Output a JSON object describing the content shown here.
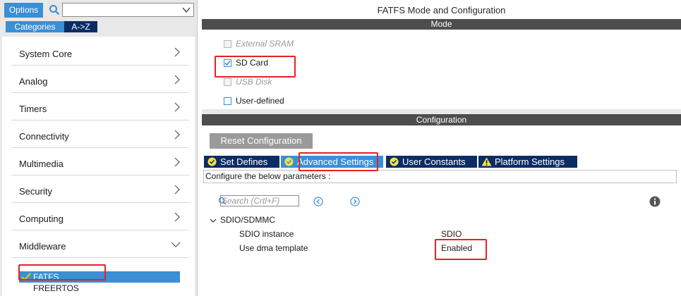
{
  "left_panel": {
    "options_button": "Options",
    "search_value": "",
    "tabs": {
      "categories": "Categories",
      "az": "A->Z"
    },
    "categories": [
      {
        "label": "System Core",
        "arrow": "chevron-right-icon"
      },
      {
        "label": "Analog",
        "arrow": "chevron-right-icon"
      },
      {
        "label": "Timers",
        "arrow": "chevron-right-icon"
      },
      {
        "label": "Connectivity",
        "arrow": "chevron-right-icon"
      },
      {
        "label": "Multimedia",
        "arrow": "chevron-right-icon"
      },
      {
        "label": "Security",
        "arrow": "chevron-right-icon"
      },
      {
        "label": "Computing",
        "arrow": "chevron-right-icon"
      },
      {
        "label": "Middleware",
        "arrow": "chevron-down-icon"
      }
    ],
    "middleware_items": [
      {
        "label": "FATFS",
        "selected": true
      },
      {
        "label": "FREERTOS",
        "selected": false
      }
    ]
  },
  "right_panel": {
    "title": "FATFS Mode and Configuration",
    "mode_header": "Mode",
    "mode_options": [
      {
        "label": "External SRAM",
        "checked": false,
        "enabled": false
      },
      {
        "label": "SD Card",
        "checked": true,
        "enabled": true
      },
      {
        "label": "USB Disk",
        "checked": false,
        "enabled": false
      },
      {
        "label": "User-defined",
        "checked": false,
        "enabled": true
      }
    ],
    "config_header": "Configuration",
    "reset_button": "Reset Configuration",
    "tabs": [
      {
        "label": "Set Defines",
        "icon": "check-circle-icon",
        "active": false
      },
      {
        "label": "Advanced Settings",
        "icon": "check-circle-icon",
        "active": true
      },
      {
        "label": "User Constants",
        "icon": "check-circle-icon",
        "active": false
      },
      {
        "label": "Platform Settings",
        "icon": "warning-icon",
        "active": false
      }
    ],
    "param_hint": "Configure the below parameters :",
    "search_placeholder": "Search (Crtl+F)",
    "group": {
      "label": "SDIO/SDMMC",
      "rows": [
        {
          "key": "SDIO instance",
          "value": "SDIO"
        },
        {
          "key": "Use dma template",
          "value": "Enabled"
        }
      ]
    }
  },
  "colors": {
    "accent": "#3a8fd6",
    "dark_tab": "#0c2d64",
    "header_bar": "#4d4d4d",
    "highlight": "#e52222"
  }
}
